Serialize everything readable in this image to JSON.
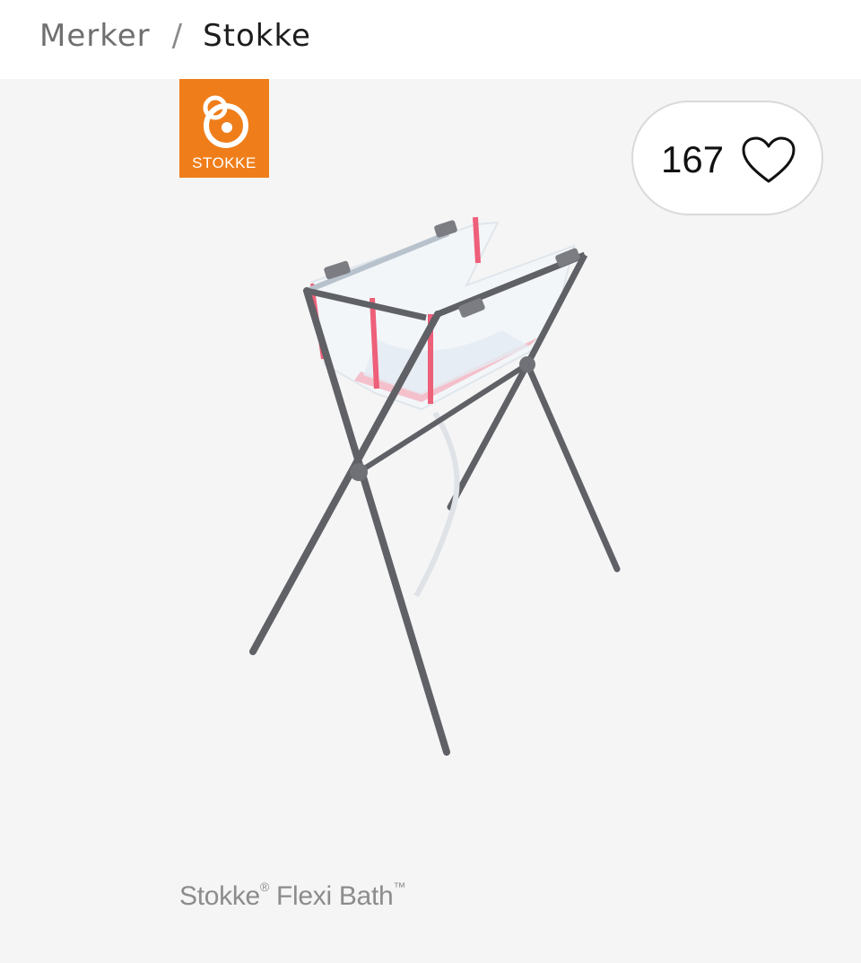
{
  "breadcrumb": {
    "parent": "Merker",
    "separator": "/",
    "current": "Stokke"
  },
  "brand_logo": {
    "text": "STOKKE",
    "color": "#ef7e1a"
  },
  "likes": {
    "count": "167",
    "icon": "heart-icon"
  },
  "product": {
    "name_main": "Stokke",
    "name_reg": "®",
    "name_rest": " Flexi Bath",
    "name_tm": "™"
  }
}
